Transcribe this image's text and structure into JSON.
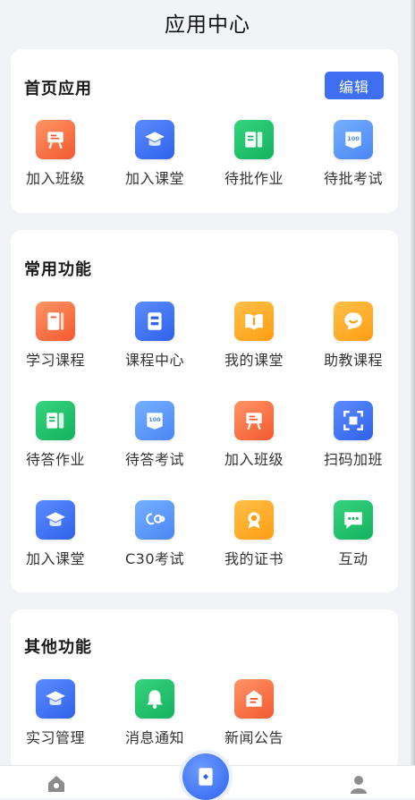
{
  "header": {
    "title": "应用中心"
  },
  "home_apps": {
    "title": "首页应用",
    "edit_label": "编辑",
    "items": [
      {
        "label": "加入班级",
        "icon": "class-board-icon",
        "color": "orange"
      },
      {
        "label": "加入课堂",
        "icon": "graduation-cap-icon",
        "color": "blue"
      },
      {
        "label": "待批作业",
        "icon": "homework-icon",
        "color": "green"
      },
      {
        "label": "待批考试",
        "icon": "exam-paper-icon",
        "color": "lblue"
      }
    ]
  },
  "common": {
    "title": "常用功能",
    "items": [
      {
        "label": "学习课程",
        "icon": "notebook-icon",
        "color": "orange"
      },
      {
        "label": "课程中心",
        "icon": "course-center-icon",
        "color": "blue"
      },
      {
        "label": "我的课堂",
        "icon": "book-icon",
        "color": "yellow"
      },
      {
        "label": "助教课程",
        "icon": "chat-bubble-icon",
        "color": "yellow"
      },
      {
        "label": "待答作业",
        "icon": "homework-icon",
        "color": "green"
      },
      {
        "label": "待答考试",
        "icon": "exam-paper-icon",
        "color": "lblue"
      },
      {
        "label": "加入班级",
        "icon": "class-board-icon",
        "color": "orange"
      },
      {
        "label": "扫码加班",
        "icon": "scan-icon",
        "color": "blue"
      },
      {
        "label": "加入课堂",
        "icon": "graduation-cap-icon",
        "color": "blue"
      },
      {
        "label": "C30考试",
        "icon": "c30-logo-icon",
        "color": "lblue"
      },
      {
        "label": "我的证书",
        "icon": "certificate-icon",
        "color": "yellow"
      },
      {
        "label": "互动",
        "icon": "message-icon",
        "color": "green"
      }
    ]
  },
  "other": {
    "title": "其他功能",
    "items": [
      {
        "label": "实习管理",
        "icon": "graduation-cap-icon",
        "color": "blue"
      },
      {
        "label": "消息通知",
        "icon": "bell-icon",
        "color": "green"
      },
      {
        "label": "新闻公告",
        "icon": "announcement-icon",
        "color": "orange"
      }
    ]
  },
  "tabbar": {
    "icons": [
      "home-icon",
      "app-center-icon",
      "user-icon"
    ]
  }
}
